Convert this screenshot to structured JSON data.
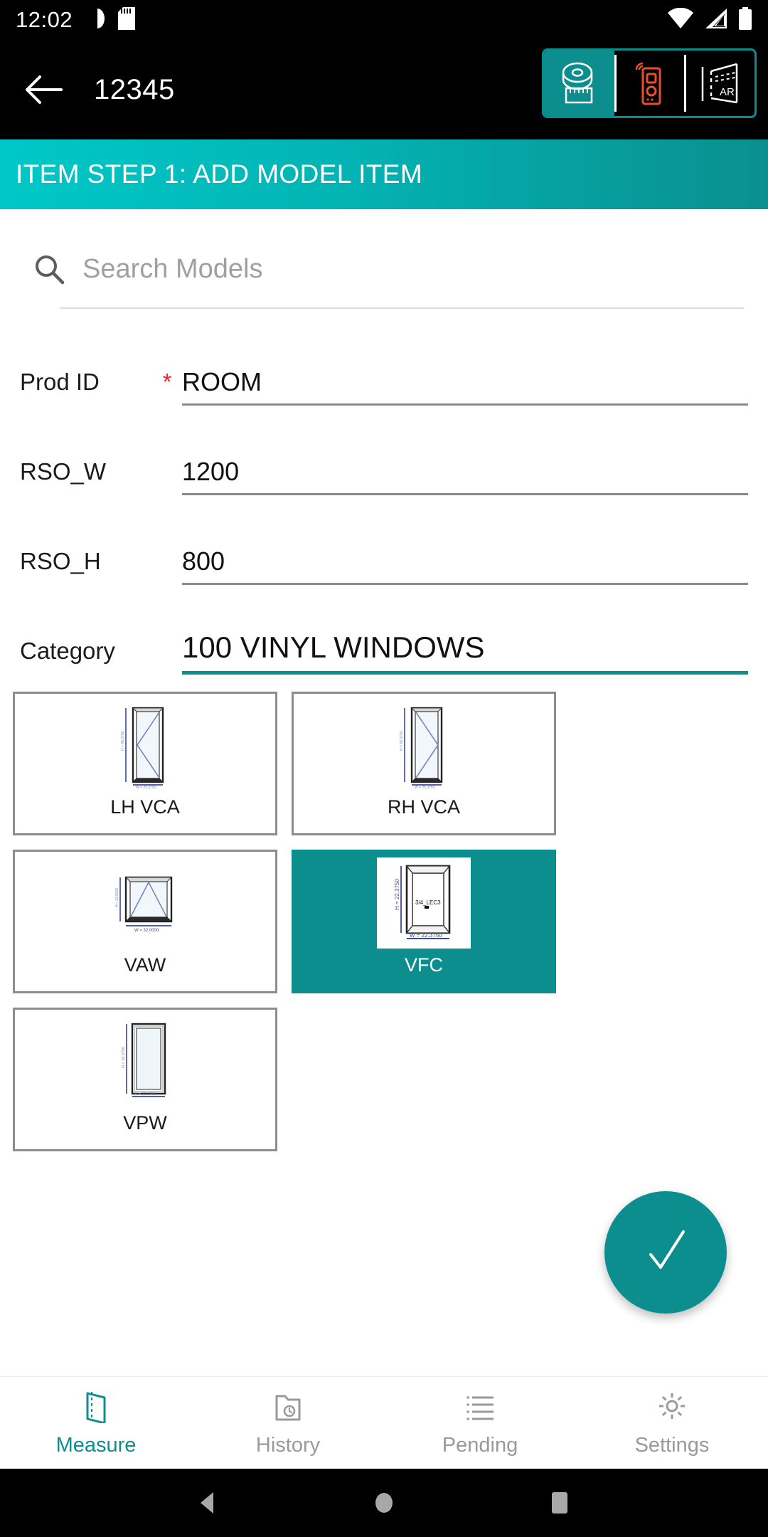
{
  "status_bar": {
    "time": "12:02",
    "icons": [
      "screen-record-icon",
      "sd-card-icon",
      "wifi-icon",
      "cellular-signal-icon",
      "battery-icon"
    ]
  },
  "app_bar": {
    "back_icon": "back-arrow-icon",
    "title": "12345",
    "modes": [
      {
        "id": "tape-measure",
        "label": "Tape Measure",
        "icon": "tape-measure-icon",
        "active": true
      },
      {
        "id": "laser-meter",
        "label": "Laser Distance Meter",
        "icon": "laser-meter-icon",
        "active": false
      },
      {
        "id": "ar-mode",
        "label": "AR",
        "icon": "ar-icon",
        "active": false
      }
    ]
  },
  "step_header": {
    "text": "ITEM STEP 1: ADD MODEL ITEM",
    "gradient_from": "#00c8c8",
    "gradient_to": "#0a8f8f"
  },
  "search": {
    "icon": "search-icon",
    "placeholder": "Search Models",
    "value": ""
  },
  "form": {
    "fields": [
      {
        "label": "Prod ID",
        "required": true,
        "value": "ROOM",
        "focused": false,
        "big": false
      },
      {
        "label": "RSO_W",
        "required": false,
        "value": "1200",
        "focused": false,
        "big": false
      },
      {
        "label": "RSO_H",
        "required": false,
        "value": "800",
        "focused": false,
        "big": false
      },
      {
        "label": "Category",
        "required": false,
        "value": "100 VINYL WINDOWS",
        "focused": true,
        "big": true
      }
    ],
    "required_marker": "*",
    "required_color": "#e8262d",
    "focus_color": "#0b8f8f"
  },
  "models": {
    "selected_color": "#0d8e8e",
    "items": [
      {
        "label": "LH VCA",
        "type": "casement-left",
        "selected": false,
        "dim_w": "W = 25.3750",
        "dim_h": "H = 49.3750"
      },
      {
        "label": "RH VCA",
        "type": "casement-right",
        "selected": false,
        "dim_w": "W = 25.3750",
        "dim_h": "H = 49.3750"
      },
      {
        "label": "VAW",
        "type": "awning",
        "selected": false,
        "dim_w": "W = 32.0000",
        "dim_h": "H = 22.0000"
      },
      {
        "label": "VFC",
        "type": "fixed-casement",
        "selected": true,
        "dim_w": "W = 22.3750",
        "dim_h": "H = 22.3750",
        "inner_label": "3/4_LEC3"
      },
      {
        "label": "VPW",
        "type": "picture",
        "selected": false,
        "dim_w": "W = 22.3750",
        "dim_h": "H = 38.3750"
      }
    ]
  },
  "fab": {
    "icon": "check-icon",
    "label": "Confirm",
    "color": "#0d8e8e"
  },
  "bottom_nav": {
    "active_color": "#0d8e8e",
    "inactive_color": "#9a9a9a",
    "items": [
      {
        "label": "Measure",
        "icon": "wall-corner-icon",
        "active": true
      },
      {
        "label": "History",
        "icon": "folder-clock-icon",
        "active": false
      },
      {
        "label": "Pending",
        "icon": "list-icon",
        "active": false
      },
      {
        "label": "Settings",
        "icon": "gear-icon",
        "active": false
      }
    ]
  },
  "android_nav": {
    "items": [
      {
        "label": "Back",
        "icon": "triangle-back-icon"
      },
      {
        "label": "Home",
        "icon": "circle-home-icon"
      },
      {
        "label": "Recents",
        "icon": "square-recents-icon"
      }
    ]
  }
}
